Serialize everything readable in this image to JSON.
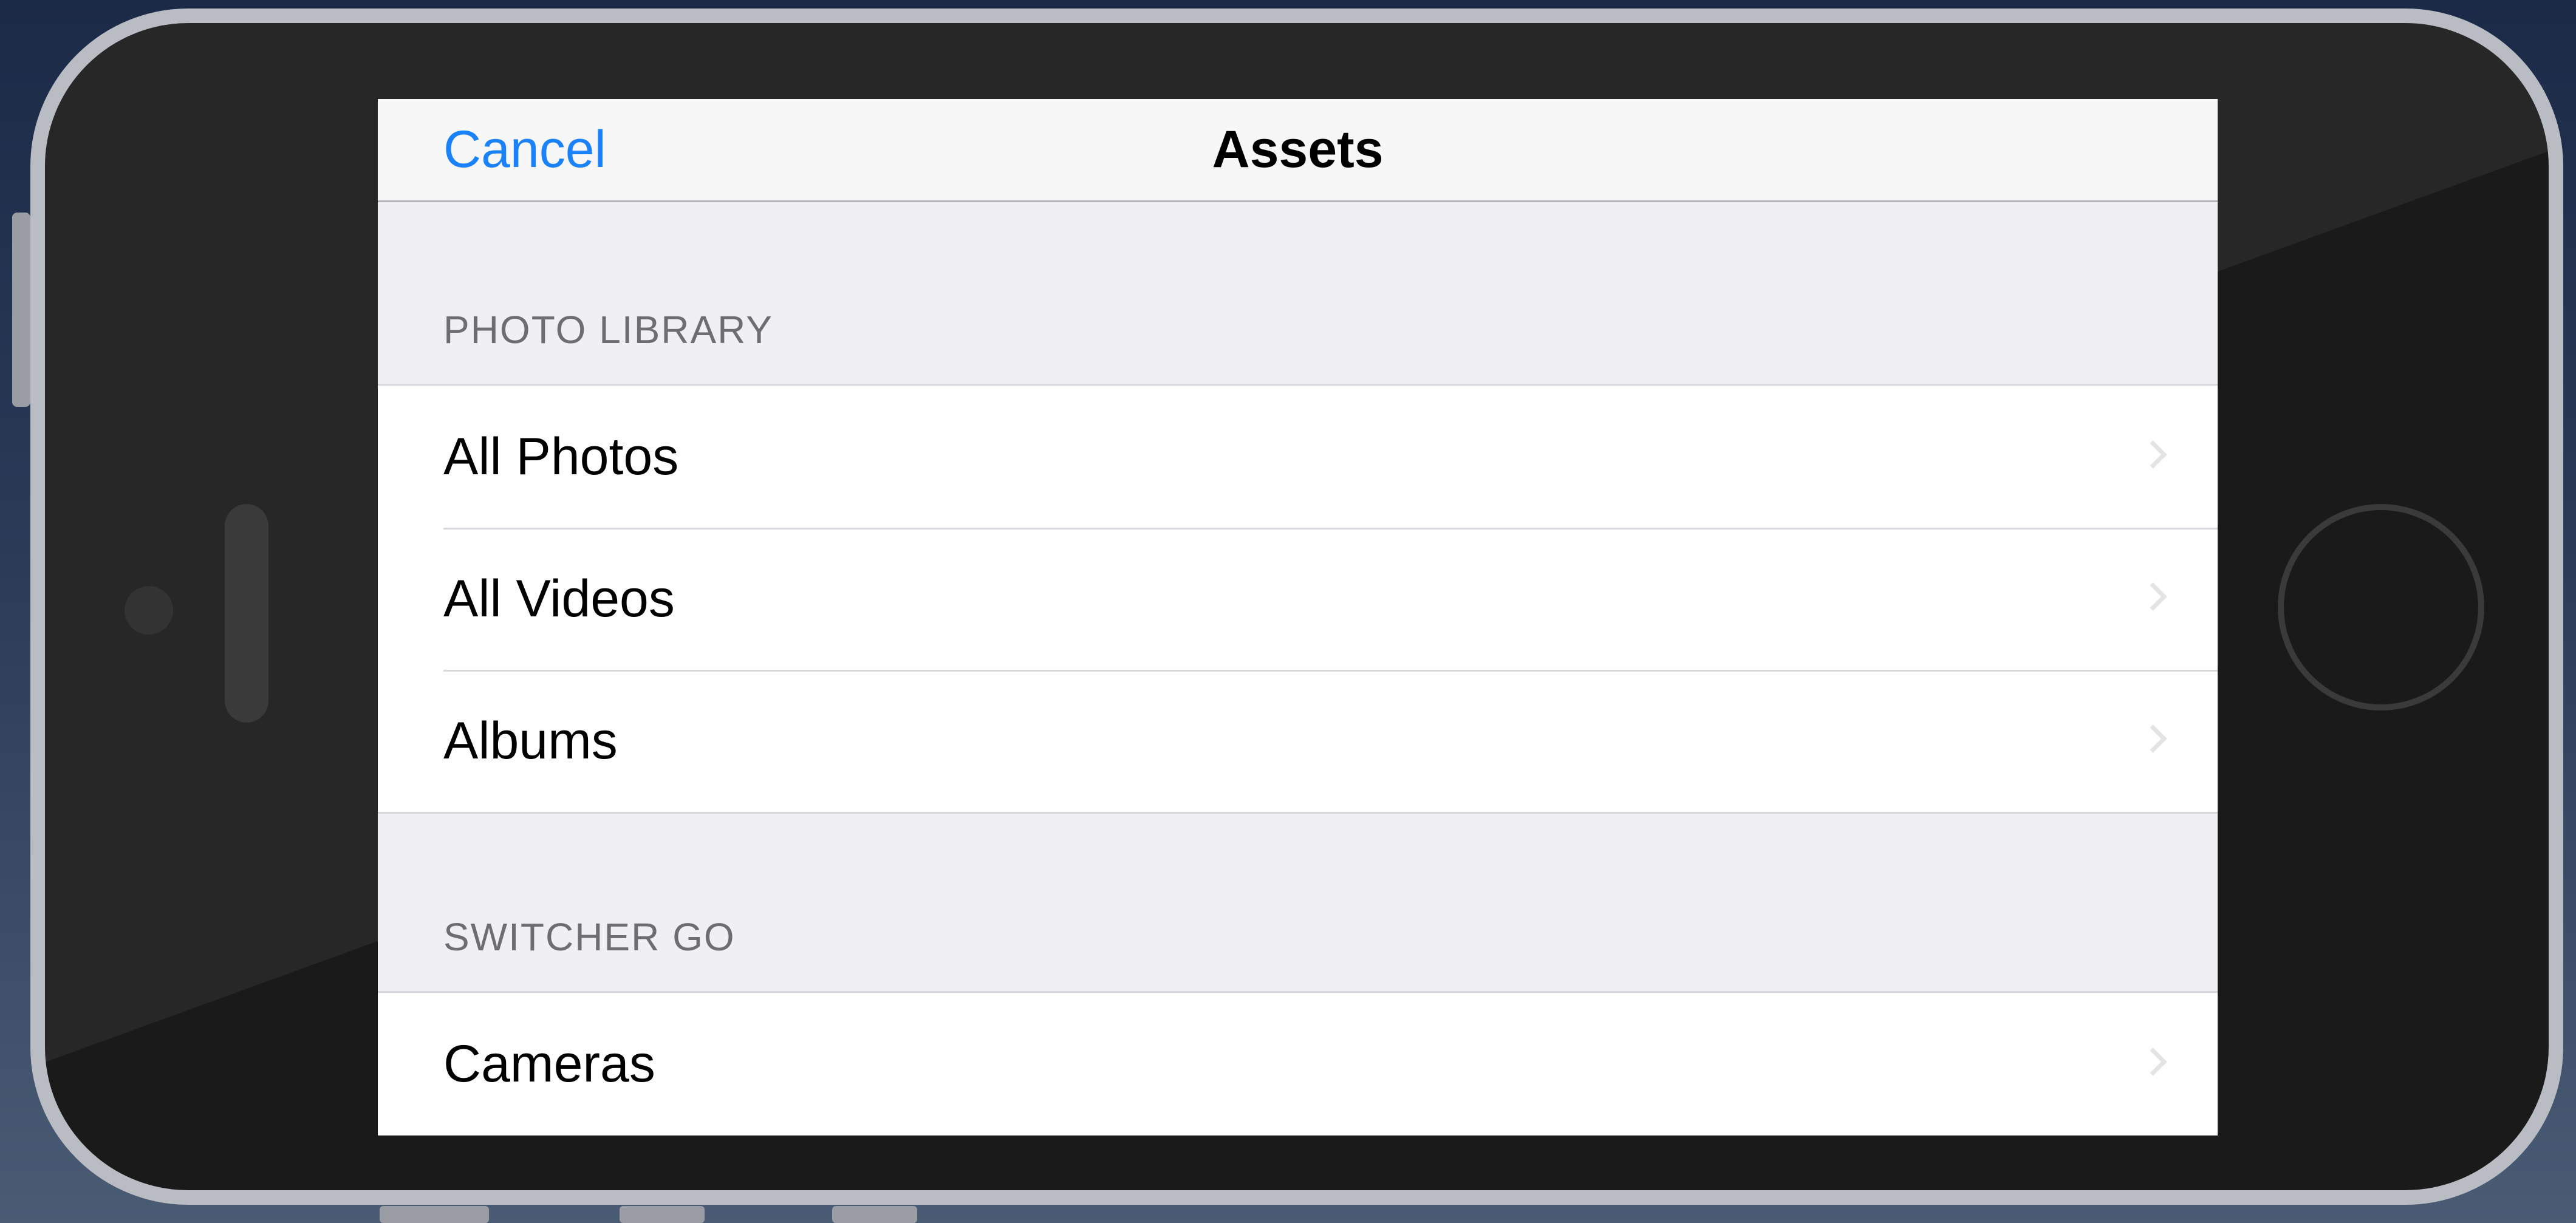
{
  "navbar": {
    "cancel_label": "Cancel",
    "title": "Assets"
  },
  "sections": [
    {
      "header": "PHOTO LIBRARY",
      "rows": [
        {
          "label": "All Photos",
          "icon": "chevron-right-icon"
        },
        {
          "label": "All Videos",
          "icon": "chevron-right-icon"
        },
        {
          "label": "Albums",
          "icon": "chevron-right-icon"
        }
      ]
    },
    {
      "header": "SWITCHER GO",
      "rows": [
        {
          "label": "Cameras",
          "icon": "chevron-right-icon"
        }
      ]
    }
  ],
  "colors": {
    "accent": "#1a82fb",
    "background": "#efeff4",
    "section_header_text": "#6d6d72"
  }
}
